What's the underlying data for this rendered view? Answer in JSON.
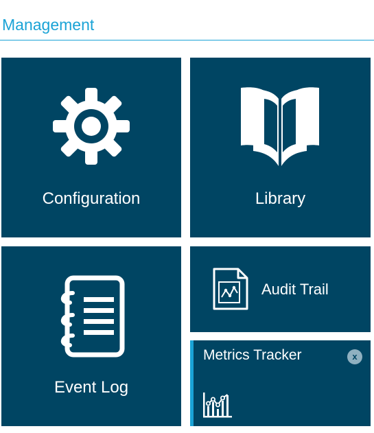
{
  "header": {
    "title": "Management"
  },
  "tiles": {
    "configuration": {
      "label": "Configuration",
      "icon": "gear-icon"
    },
    "library": {
      "label": "Library",
      "icon": "open-book-icon"
    },
    "event_log": {
      "label": "Event Log",
      "icon": "notebook-icon"
    },
    "audit_trail": {
      "label": "Audit Trail",
      "icon": "document-chart-icon"
    },
    "metrics_tracker": {
      "label": "Metrics Tracker",
      "close_label": "x",
      "icon": "line-chart-icon"
    }
  },
  "colors": {
    "accent": "#1aa3d6",
    "tile_background": "#004563",
    "tile_text": "#ffffff"
  }
}
